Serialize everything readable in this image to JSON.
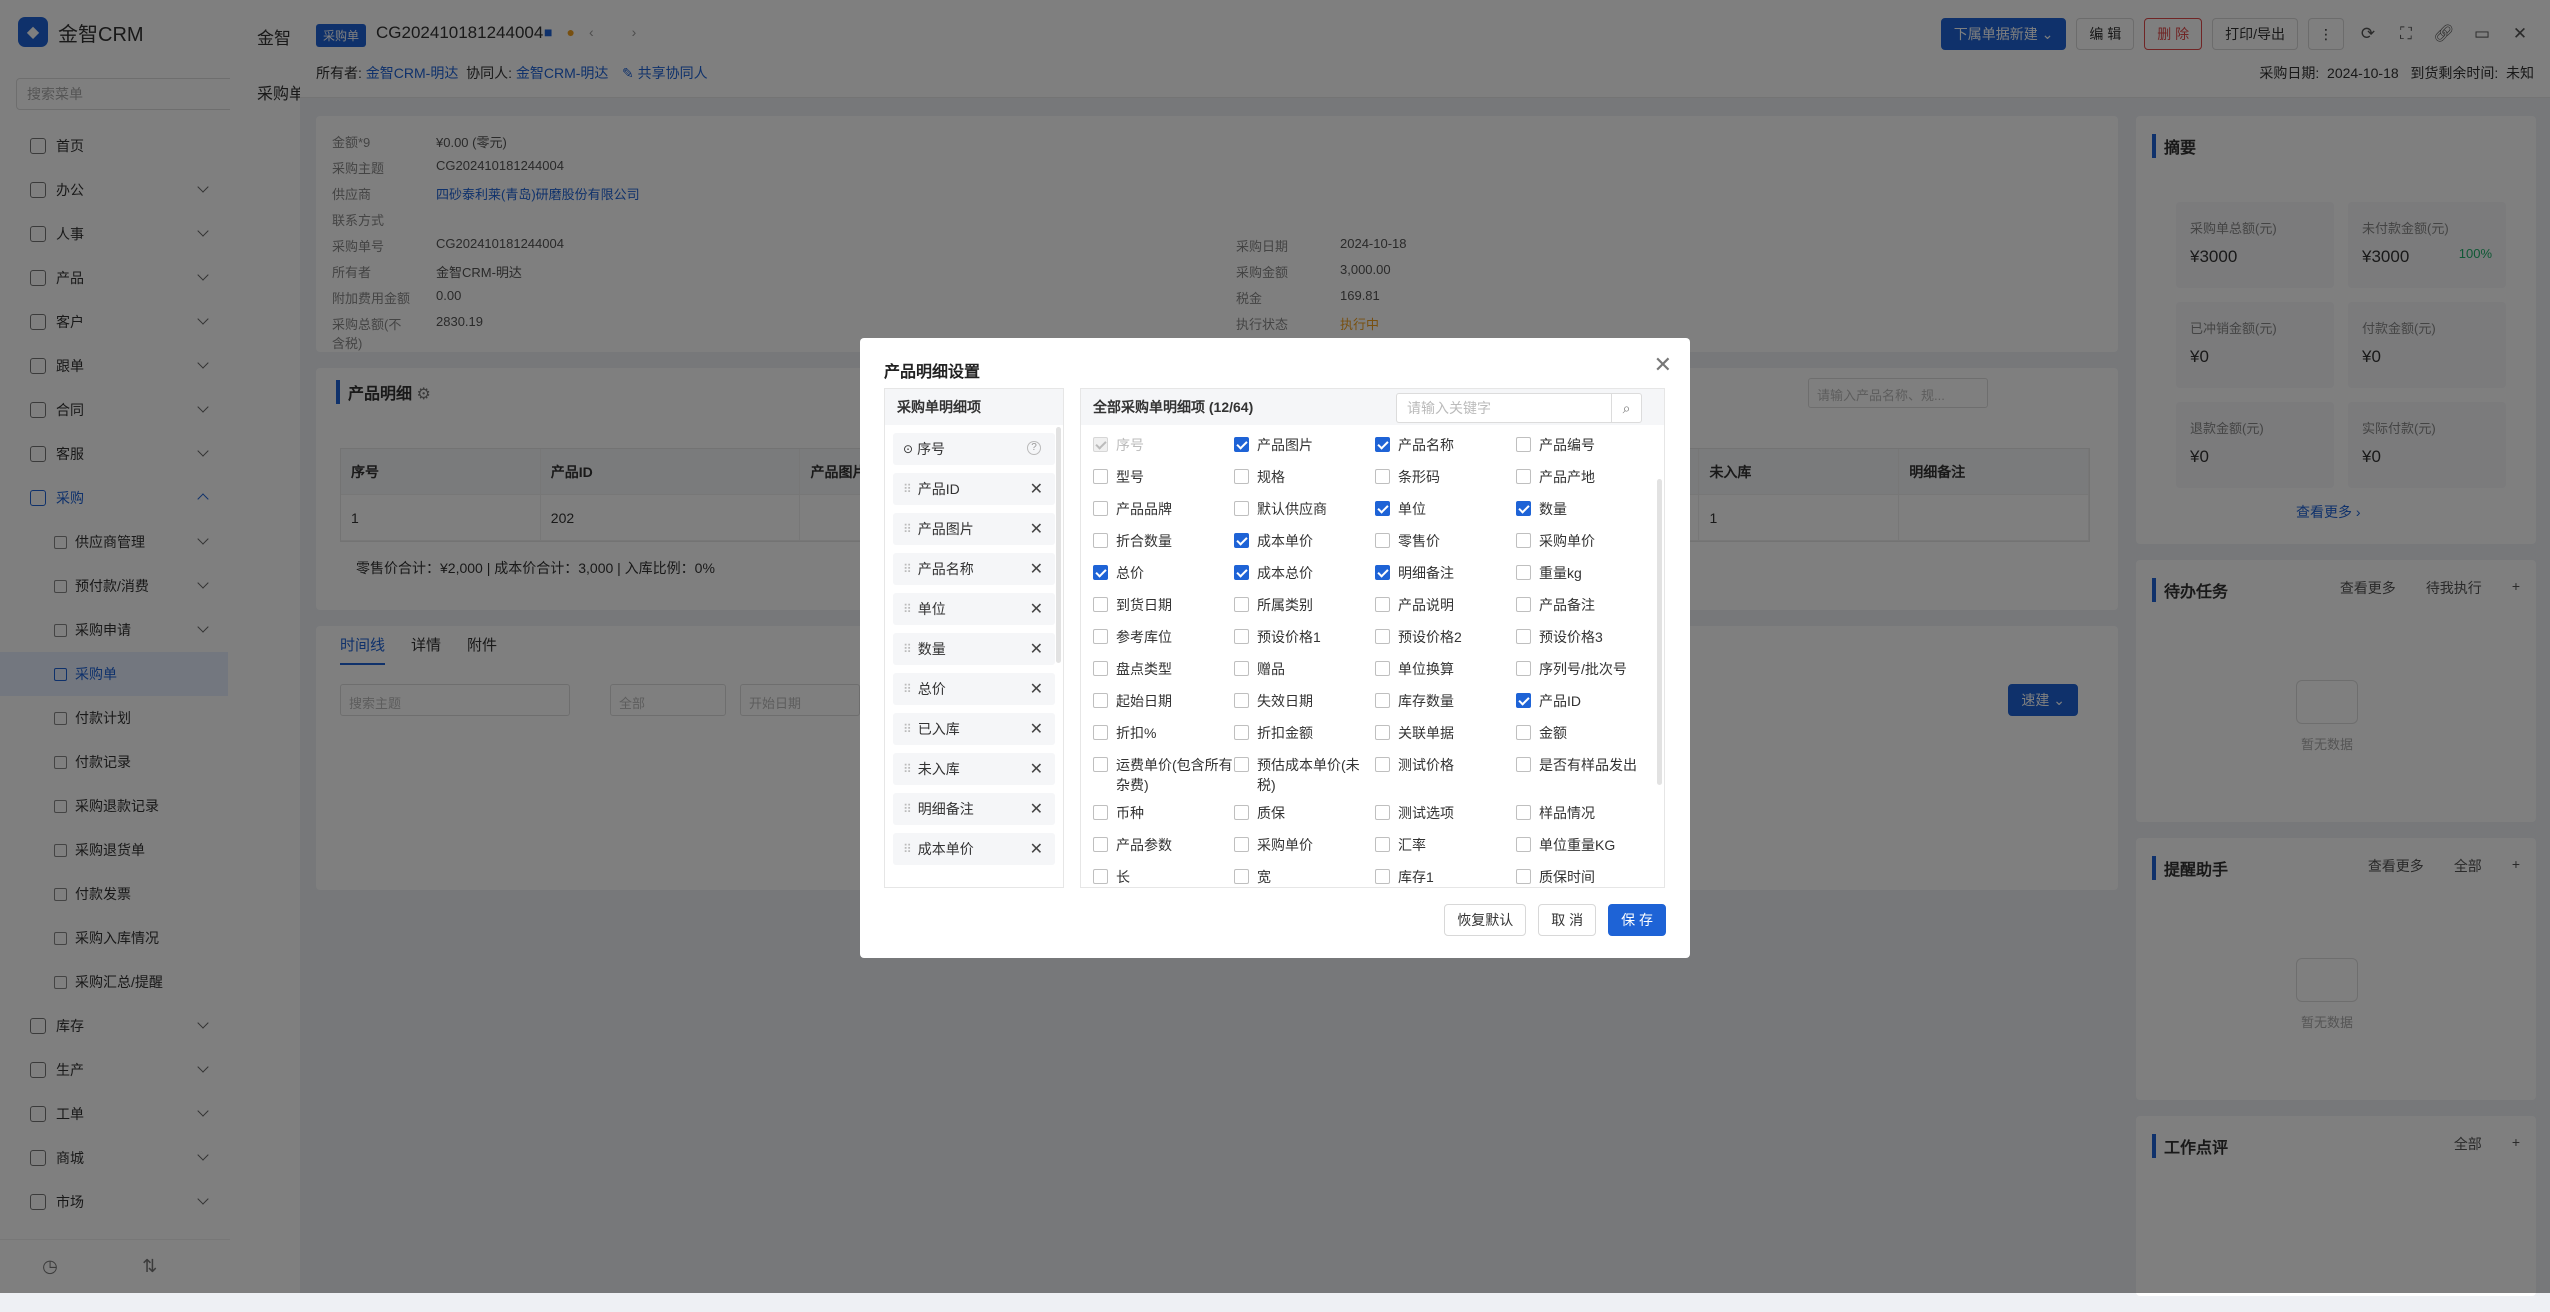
{
  "app": {
    "name": "金智CRM",
    "search_placeholder": "搜索菜单"
  },
  "sidebar": {
    "items": [
      {
        "label": "首页"
      },
      {
        "label": "办公"
      },
      {
        "label": "人事"
      },
      {
        "label": "产品"
      },
      {
        "label": "客户"
      },
      {
        "label": "跟单"
      },
      {
        "label": "合同"
      },
      {
        "label": "客服"
      },
      {
        "label": "采购"
      }
    ],
    "sub_items": [
      {
        "label": "供应商管理"
      },
      {
        "label": "预付款/消费"
      },
      {
        "label": "采购申请"
      },
      {
        "label": "采购单"
      },
      {
        "label": "付款计划"
      },
      {
        "label": "付款记录"
      },
      {
        "label": "采购退款记录"
      },
      {
        "label": "采购退货单"
      },
      {
        "label": "付款发票"
      },
      {
        "label": "采购入库情况"
      },
      {
        "label": "采购汇总/提醒"
      }
    ],
    "bottom_items": [
      {
        "label": "库存"
      },
      {
        "label": "生产"
      },
      {
        "label": "工单"
      },
      {
        "label": "商城"
      },
      {
        "label": "市场"
      }
    ]
  },
  "mid": {
    "header": "金智",
    "sub": "采购单"
  },
  "header": {
    "tag": "采购单",
    "order_no": "CG202410181244004",
    "owner_label": "所有者:",
    "owner": "金智CRM-明达",
    "collab_label": "协同人:",
    "collab": "金智CRM-明达",
    "share": "共享协同人",
    "buttons": {
      "new": "下属单据新建",
      "edit": "编 辑",
      "delete": "删 除",
      "print": "打印/导出"
    },
    "purchase_date_label": "采购日期:",
    "purchase_date": "2024-10-18",
    "remaining_label": "到货剩余时间:",
    "remaining": "未知"
  },
  "info": {
    "left": [
      {
        "k": "金额*9",
        "v": "¥0.00 (零元)"
      },
      {
        "k": "采购主题",
        "v": "CG202410181244004"
      },
      {
        "k": "供应商",
        "v": "四砂泰利莱(青岛)研磨股份有限公司"
      },
      {
        "k": "联系方式",
        "v": ""
      },
      {
        "k": "采购单号",
        "v": "CG202410181244004"
      },
      {
        "k": "所有者",
        "v": "金智CRM-明达"
      },
      {
        "k": "附加费用金额",
        "v": "0.00"
      },
      {
        "k": "采购总额(不含税)",
        "v": "2830.19"
      }
    ],
    "right": [
      {
        "k": "采购日期",
        "v": "2024-10-18"
      },
      {
        "k": "采购金额",
        "v": "3,000.00"
      },
      {
        "k": "税金",
        "v": "169.81"
      },
      {
        "k": "执行状态",
        "v": "执行中"
      }
    ]
  },
  "product": {
    "title": "产品明细",
    "search_placeholder": "请输入产品名称、规...",
    "columns": [
      "序号",
      "产品ID",
      "产品图片",
      "未入库",
      "明细备注"
    ],
    "row": [
      "1",
      "202",
      "",
      "1",
      ""
    ],
    "totals": "零售价合计：¥2,000 |   成本价合计：3,000 |   入库比例：0%"
  },
  "timeline": {
    "tabs": [
      "时间线",
      "详情",
      "附件"
    ],
    "search_placeholder": "搜索主题",
    "filter": "全部",
    "start_date": "开始日期",
    "quick": "速建"
  },
  "summary": {
    "title": "摘要",
    "cells": [
      {
        "label": "采购单总额(元)",
        "value": "¥3000"
      },
      {
        "label": "未付款金额(元)",
        "value": "¥3000",
        "pct": "100%"
      },
      {
        "label": "已冲销金额(元)",
        "value": "¥0"
      },
      {
        "label": "付款金额(元)",
        "value": "¥0"
      },
      {
        "label": "退款金额(元)",
        "value": "¥0"
      },
      {
        "label": "实际付款(元)",
        "value": "¥0"
      }
    ],
    "more": "查看更多"
  },
  "todo": {
    "title": "待办任务",
    "more": "查看更多",
    "filter": "待我执行",
    "empty": "暂无数据"
  },
  "reminder": {
    "title": "提醒助手",
    "more": "查看更多",
    "filter": "全部",
    "empty": "暂无数据"
  },
  "review": {
    "title": "工作点评",
    "filter": "全部"
  },
  "modal": {
    "title": "产品明细设置",
    "left_header": "采购单明细项",
    "selected": [
      "序号",
      "产品ID",
      "产品图片",
      "产品名称",
      "单位",
      "数量",
      "总价",
      "已入库",
      "未入库",
      "明细备注",
      "成本单价"
    ],
    "right_header": "全部采购单明细项 (12/64)",
    "keyword_placeholder": "请输入关键字",
    "options": [
      {
        "label": "序号",
        "checked": true,
        "disabled": true
      },
      {
        "label": "产品图片",
        "checked": true
      },
      {
        "label": "产品名称",
        "checked": true
      },
      {
        "label": "产品编号",
        "checked": false
      },
      {
        "label": "型号",
        "checked": false
      },
      {
        "label": "规格",
        "checked": false
      },
      {
        "label": "条形码",
        "checked": false
      },
      {
        "label": "产品产地",
        "checked": false
      },
      {
        "label": "产品品牌",
        "checked": false
      },
      {
        "label": "默认供应商",
        "checked": false
      },
      {
        "label": "单位",
        "checked": true
      },
      {
        "label": "数量",
        "checked": true
      },
      {
        "label": "折合数量",
        "checked": false
      },
      {
        "label": "成本单价",
        "checked": true
      },
      {
        "label": "零售价",
        "checked": false
      },
      {
        "label": "采购单价",
        "checked": false
      },
      {
        "label": "总价",
        "checked": true
      },
      {
        "label": "成本总价",
        "checked": true
      },
      {
        "label": "明细备注",
        "checked": true
      },
      {
        "label": "重量kg",
        "checked": false
      },
      {
        "label": "到货日期",
        "checked": false
      },
      {
        "label": "所属类别",
        "checked": false
      },
      {
        "label": "产品说明",
        "checked": false
      },
      {
        "label": "产品备注",
        "checked": false
      },
      {
        "label": "参考库位",
        "checked": false
      },
      {
        "label": "预设价格1",
        "checked": false
      },
      {
        "label": "预设价格2",
        "checked": false
      },
      {
        "label": "预设价格3",
        "checked": false
      },
      {
        "label": "盘点类型",
        "checked": false
      },
      {
        "label": "赠品",
        "checked": false
      },
      {
        "label": "单位换算",
        "checked": false
      },
      {
        "label": "序列号/批次号",
        "checked": false
      },
      {
        "label": "起始日期",
        "checked": false
      },
      {
        "label": "失效日期",
        "checked": false
      },
      {
        "label": "库存数量",
        "checked": false
      },
      {
        "label": "产品ID",
        "checked": true
      },
      {
        "label": "折扣%",
        "checked": false
      },
      {
        "label": "折扣金额",
        "checked": false
      },
      {
        "label": "关联单据",
        "checked": false
      },
      {
        "label": "金额",
        "checked": false
      },
      {
        "label": "运费单价(包含所有杂费)",
        "checked": false
      },
      {
        "label": "预估成本单价(未税)",
        "checked": false
      },
      {
        "label": "测试价格",
        "checked": false
      },
      {
        "label": "是否有样品发出",
        "checked": false
      },
      {
        "label": "币种",
        "checked": false
      },
      {
        "label": "质保",
        "checked": false
      },
      {
        "label": "测试选项",
        "checked": false
      },
      {
        "label": "样品情况",
        "checked": false
      },
      {
        "label": "产品参数",
        "checked": false
      },
      {
        "label": "采购单价",
        "checked": false
      },
      {
        "label": "汇率",
        "checked": false
      },
      {
        "label": "单位重量KG",
        "checked": false
      },
      {
        "label": "长",
        "checked": false
      },
      {
        "label": "宽",
        "checked": false
      },
      {
        "label": "库存1",
        "checked": false
      },
      {
        "label": "质保时间",
        "checked": false
      }
    ],
    "buttons": {
      "reset": "恢复默认",
      "cancel": "取 消",
      "save": "保 存"
    }
  },
  "colors": {
    "primary": "#1e63d6",
    "danger": "#e04b4b",
    "success": "#20b16b",
    "warn": "#f0a020"
  }
}
